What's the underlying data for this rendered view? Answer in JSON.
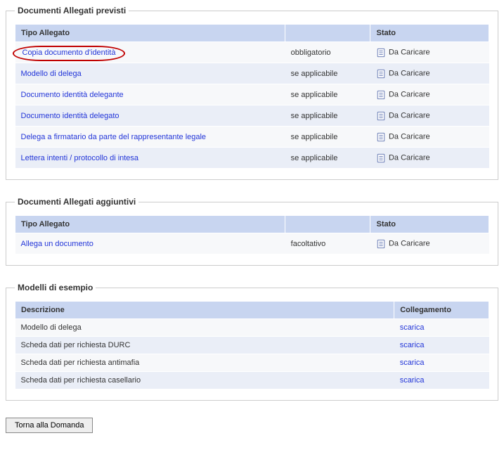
{
  "section1": {
    "legend": "Documenti Allegati previsti",
    "headers": {
      "tipo": "Tipo Allegato",
      "stato": "Stato"
    },
    "rows": [
      {
        "tipo": "Copia documento d'identità",
        "obbl": "obbligatorio",
        "stato": "Da Caricare",
        "highlighted": true
      },
      {
        "tipo": "Modello di delega",
        "obbl": "se applicabile",
        "stato": "Da Caricare"
      },
      {
        "tipo": "Documento identità delegante",
        "obbl": "se applicabile",
        "stato": "Da Caricare"
      },
      {
        "tipo": "Documento identità delegato",
        "obbl": "se applicabile",
        "stato": "Da Caricare"
      },
      {
        "tipo": "Delega a firmatario da parte del rappresentante legale",
        "obbl": "se applicabile",
        "stato": "Da Caricare"
      },
      {
        "tipo": "Lettera intenti / protocollo di intesa",
        "obbl": "se applicabile",
        "stato": "Da Caricare"
      }
    ]
  },
  "section2": {
    "legend": "Documenti Allegati aggiuntivi",
    "headers": {
      "tipo": "Tipo Allegato",
      "stato": "Stato"
    },
    "rows": [
      {
        "tipo": "Allega un documento",
        "obbl": "facoltativo",
        "stato": "Da Caricare"
      }
    ]
  },
  "section3": {
    "legend": "Modelli di esempio",
    "headers": {
      "descr": "Descrizione",
      "link": "Collegamento"
    },
    "rows": [
      {
        "descr": "Modello di delega",
        "link": "scarica"
      },
      {
        "descr": "Scheda dati per richiesta DURC",
        "link": "scarica"
      },
      {
        "descr": "Scheda dati per richiesta antimafia",
        "link": "scarica"
      },
      {
        "descr": "Scheda dati per richiesta casellario",
        "link": "scarica"
      }
    ]
  },
  "footer": {
    "back_button": "Torna alla Domanda"
  }
}
